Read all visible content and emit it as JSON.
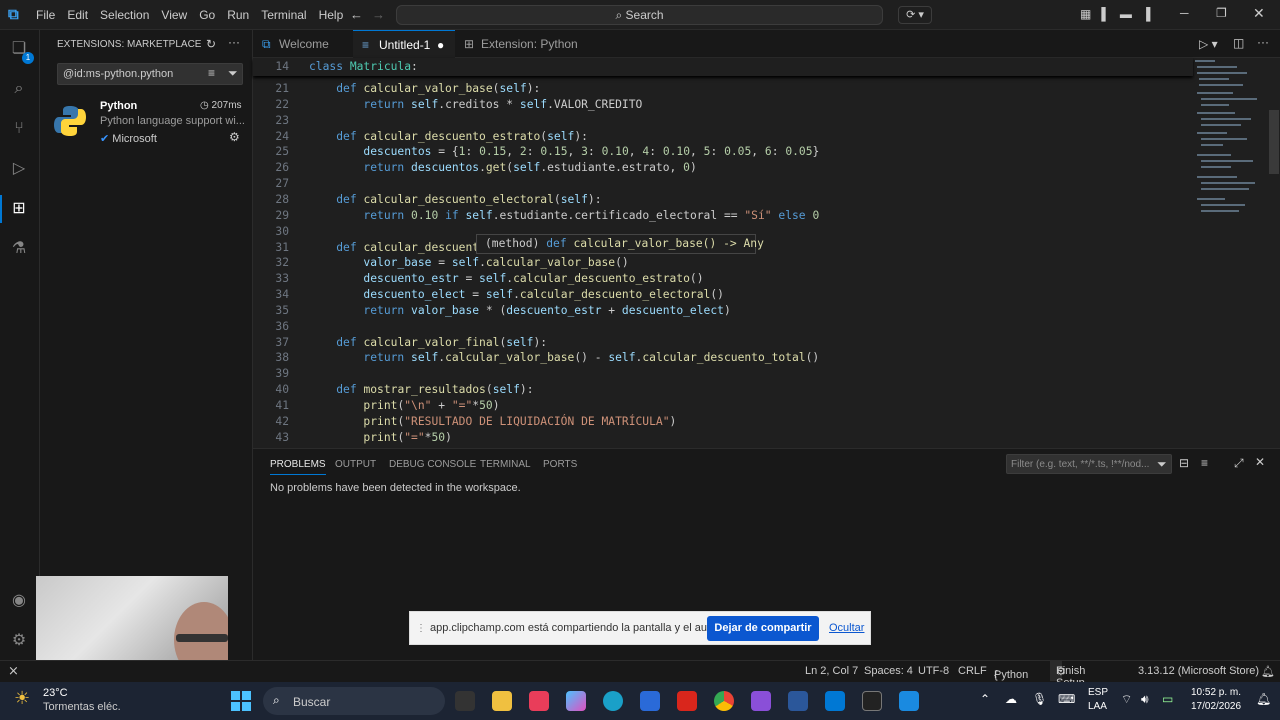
{
  "menu": [
    "File",
    "Edit",
    "Selection",
    "View",
    "Go",
    "Run",
    "Terminal",
    "Help"
  ],
  "search_label": "Search",
  "sidebar": {
    "title": "EXTENSIONS: MARKETPLACE",
    "filter": "@id:ms-python.python",
    "ext_name": "Python",
    "ext_time": "207ms",
    "ext_desc": "Python language support wi...",
    "ext_publisher": "Microsoft"
  },
  "tabs": [
    "Welcome",
    "Untitled-1",
    "Extension: Python"
  ],
  "breadcrumb_line_no": "14",
  "breadcrumb": "class Matricula:",
  "hover_tip": {
    "prefix": "(method)",
    "kw": "def",
    "sig": "calcular_valor_base() -> Any"
  },
  "code": [
    {
      "n": "21",
      "html": "    <span class='kw'>def</span> <span class='fn'>calcular_valor_base</span>(<span class='sf'>self</span>):"
    },
    {
      "n": "22",
      "html": "        <span class='kw'>return</span> <span class='sf'>self</span>.creditos * <span class='sf'>self</span>.VALOR_CREDITO"
    },
    {
      "n": "23",
      "html": ""
    },
    {
      "n": "24",
      "html": "    <span class='kw'>def</span> <span class='fn'>calcular_descuento_estrato</span>(<span class='sf'>self</span>):"
    },
    {
      "n": "25",
      "html": "        <span class='sf'>descuentos</span> = {<span class='num'>1</span>: <span class='num'>0.15</span>, <span class='num'>2</span>: <span class='num'>0.15</span>, <span class='num'>3</span>: <span class='num'>0.10</span>, <span class='num'>4</span>: <span class='num'>0.10</span>, <span class='num'>5</span>: <span class='num'>0.05</span>, <span class='num'>6</span>: <span class='num'>0.05</span>}"
    },
    {
      "n": "26",
      "html": "        <span class='kw'>return</span> <span class='sf'>descuentos</span>.<span class='fn'>get</span>(<span class='sf'>self</span>.estudiante.estrato, <span class='num'>0</span>)"
    },
    {
      "n": "27",
      "html": ""
    },
    {
      "n": "28",
      "html": "    <span class='kw'>def</span> <span class='fn'>calcular_descuento_electoral</span>(<span class='sf'>self</span>):"
    },
    {
      "n": "29",
      "html": "        <span class='kw'>return</span> <span class='num'>0.10</span> <span class='kw'>if</span> <span class='sf'>self</span>.estudiante.certificado_electoral == <span class='str'>\"Sí\"</span> <span class='kw'>else</span> <span class='num'>0</span>"
    },
    {
      "n": "30",
      "html": ""
    },
    {
      "n": "31",
      "html": "    <span class='kw'>def</span> <span class='fn'>calcular_descuento</span>"
    },
    {
      "n": "32",
      "html": "        <span class='sf'>valor_base</span> = <span class='sf'>self</span>.<span class='fn'>calcular_valor_base</span>()"
    },
    {
      "n": "33",
      "html": "        <span class='sf'>descuento_estr</span> = <span class='sf'>self</span>.<span class='fn'>calcular_descuento_estrato</span>()"
    },
    {
      "n": "34",
      "html": "        <span class='sf'>descuento_elect</span> = <span class='sf'>self</span>.<span class='fn'>calcular_descuento_electoral</span>()"
    },
    {
      "n": "35",
      "html": "        <span class='kw'>return</span> <span class='sf'>valor_base</span> * (<span class='sf'>descuento_estr</span> + <span class='sf'>descuento_elect</span>)"
    },
    {
      "n": "36",
      "html": ""
    },
    {
      "n": "37",
      "html": "    <span class='kw'>def</span> <span class='fn'>calcular_valor_final</span>(<span class='sf'>self</span>):"
    },
    {
      "n": "38",
      "html": "        <span class='kw'>return</span> <span class='sf'>self</span>.<span class='fn'>calcular_valor_base</span>() - <span class='sf'>self</span>.<span class='fn'>calcular_descuento_total</span>()"
    },
    {
      "n": "39",
      "html": ""
    },
    {
      "n": "40",
      "html": "    <span class='kw'>def</span> <span class='fn'>mostrar_resultados</span>(<span class='sf'>self</span>):"
    },
    {
      "n": "41",
      "html": "        <span class='fn'>print</span>(<span class='str'>\"\\n\"</span> + <span class='str'>\"=\"</span>*<span class='num'>50</span>)"
    },
    {
      "n": "42",
      "html": "        <span class='fn'>print</span>(<span class='str'>\"RESULTADO DE LIQUIDACIÓN DE MATRÍCULA\"</span>)"
    },
    {
      "n": "43",
      "html": "        <span class='fn'>print</span>(<span class='str'>\"=\"</span>*<span class='num'>50</span>)"
    }
  ],
  "panel": {
    "tabs": [
      "PROBLEMS",
      "OUTPUT",
      "DEBUG CONSOLE",
      "TERMINAL",
      "PORTS"
    ],
    "filter_placeholder": "Filter (e.g. text, **/*.ts, !**/nod...",
    "message": "No problems have been detected in the workspace."
  },
  "notification": {
    "text": "app.clipchamp.com está compartiendo la pantalla y el audio.",
    "stop": "Dejar de compartir",
    "hide": "Ocultar"
  },
  "status": {
    "position": "Ln 2, Col 7",
    "spaces": "Spaces: 4",
    "encoding": "UTF-8",
    "eol": "CRLF",
    "language": "Python",
    "finish": "Finish Setup",
    "interpreter": "3.13.12 (Microsoft Store)"
  },
  "taskbar": {
    "temp": "23°C",
    "weather": "Tormentas eléc.",
    "search": "Buscar",
    "lang1": "ESP",
    "lang2": "LAA",
    "time": "10:52 p. m.",
    "date": "17/02/2026"
  }
}
